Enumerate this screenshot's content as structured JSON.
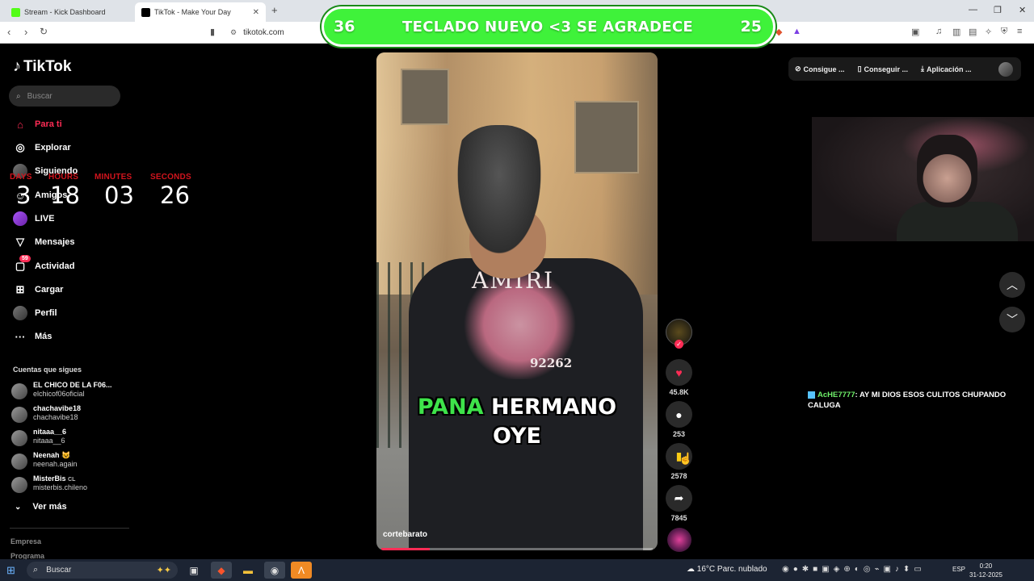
{
  "browser": {
    "tabs": [
      {
        "label": "Stream - Kick Dashboard",
        "active": false
      },
      {
        "label": "TikTok - Make Your Day",
        "active": true
      }
    ],
    "url": "tikotok.com"
  },
  "overlay": {
    "left_number": "36",
    "message": "TECLADO NUEVO <3 SE AGRADECE",
    "right_number": "25",
    "color": "#3ff23a"
  },
  "countdown": {
    "labels": {
      "days": "DAYS",
      "hours": "HOURS",
      "minutes": "MINUTES",
      "seconds": "SECONDS"
    },
    "values": {
      "days": "3",
      "hours": "18",
      "minutes": "03",
      "seconds": "26"
    },
    "label_color": "#d1141d"
  },
  "sidebar": {
    "brand": "TikTok",
    "search_placeholder": "Buscar",
    "nav": [
      {
        "label": "Para ti",
        "icon": "home-icon",
        "active": true
      },
      {
        "label": "Explorar",
        "icon": "compass-icon"
      },
      {
        "label": "Siguiendo",
        "icon": "avatar-icon"
      },
      {
        "label": "Amigos",
        "icon": "friends-icon"
      },
      {
        "label": "LIVE",
        "icon": "live-icon"
      },
      {
        "label": "Mensajes",
        "icon": "send-icon"
      },
      {
        "label": "Actividad",
        "icon": "inbox-icon",
        "badge": "59"
      },
      {
        "label": "Cargar",
        "icon": "upload-icon"
      },
      {
        "label": "Perfil",
        "icon": "profile-icon"
      },
      {
        "label": "Más",
        "icon": "more-icon"
      }
    ],
    "following_title": "Cuentas que sigues",
    "following": [
      {
        "name": "EL CHICO DE LA F06...",
        "handle": "elchicof06oficial"
      },
      {
        "name": "chachavibe18",
        "handle": "chachavibe18"
      },
      {
        "name": "nitaaa__6",
        "handle": "nitaaa__6"
      },
      {
        "name": "Neenah 😺",
        "handle": "neenah.again"
      },
      {
        "name": "MisterBis",
        "handle": "misterbis.chileno",
        "flag": "CL"
      }
    ],
    "see_more": "Ver más",
    "footer": [
      "Empresa",
      "Programa"
    ],
    "accent": "#fe2c55"
  },
  "video": {
    "caption_highlight": "PANA",
    "caption_line1_rest": "HERMANO",
    "caption_line2": "OYE",
    "shirt_brand": "AMIRI",
    "shirt_number": "92262",
    "author": "cortebarato",
    "progress": 0.18
  },
  "actions": {
    "likes": "45.8K",
    "comments": "253",
    "saves": "2578",
    "shares": "7845"
  },
  "topright": {
    "chips": [
      {
        "label": "Consigue ...",
        "icon": "coin-icon"
      },
      {
        "label": "Conseguir ...",
        "icon": "phone-icon"
      },
      {
        "label": "Aplicación ...",
        "icon": "download-icon"
      }
    ]
  },
  "chat": {
    "user": "AcHE7777",
    "message": "AY MI DIOS ESOS CULITOS CHUPANDO CALUGA"
  },
  "taskbar": {
    "search_placeholder": "Buscar",
    "weather": "16°C  Parc. nublado",
    "lang": "ESP",
    "time": "0:20",
    "date": "31-12-2025"
  }
}
